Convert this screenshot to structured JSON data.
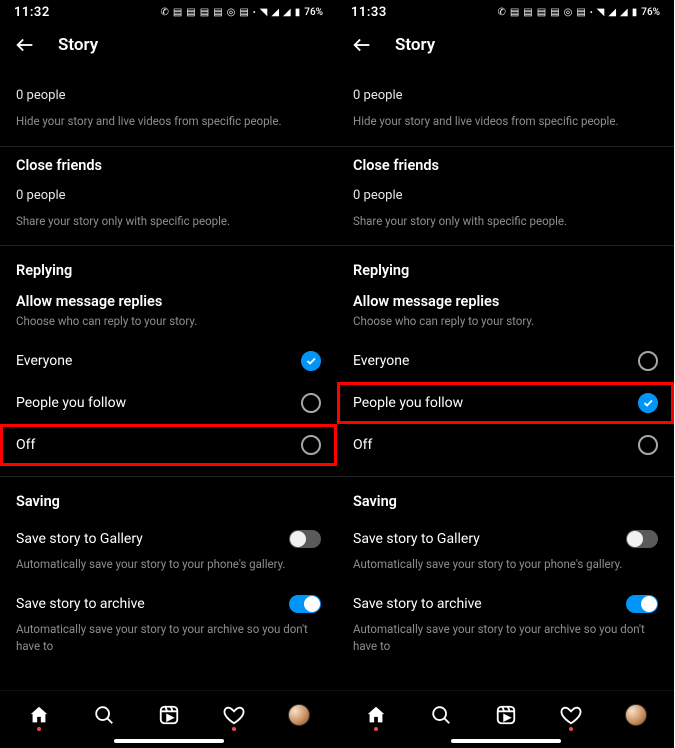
{
  "status": {
    "left_time": "11:32",
    "right_time": "11:33",
    "battery": "76%"
  },
  "header": {
    "title": "Story"
  },
  "hide": {
    "count": "0 people",
    "sub": "Hide your story and live videos from specific people."
  },
  "close_friends": {
    "title": "Close friends",
    "count": "0 people",
    "sub": "Share your story only with specific people."
  },
  "replying": {
    "label": "Replying",
    "title": "Allow message replies",
    "sub": "Choose who can reply to your story.",
    "opts": {
      "everyone": "Everyone",
      "follow": "People you follow",
      "off": "Off"
    }
  },
  "saving": {
    "label": "Saving",
    "gallery": {
      "title": "Save story to Gallery",
      "sub": "Automatically save your story to your phone's gallery."
    },
    "archive": {
      "title": "Save story to archive",
      "sub": "Automatically save your story to your archive so you don't have to"
    }
  }
}
